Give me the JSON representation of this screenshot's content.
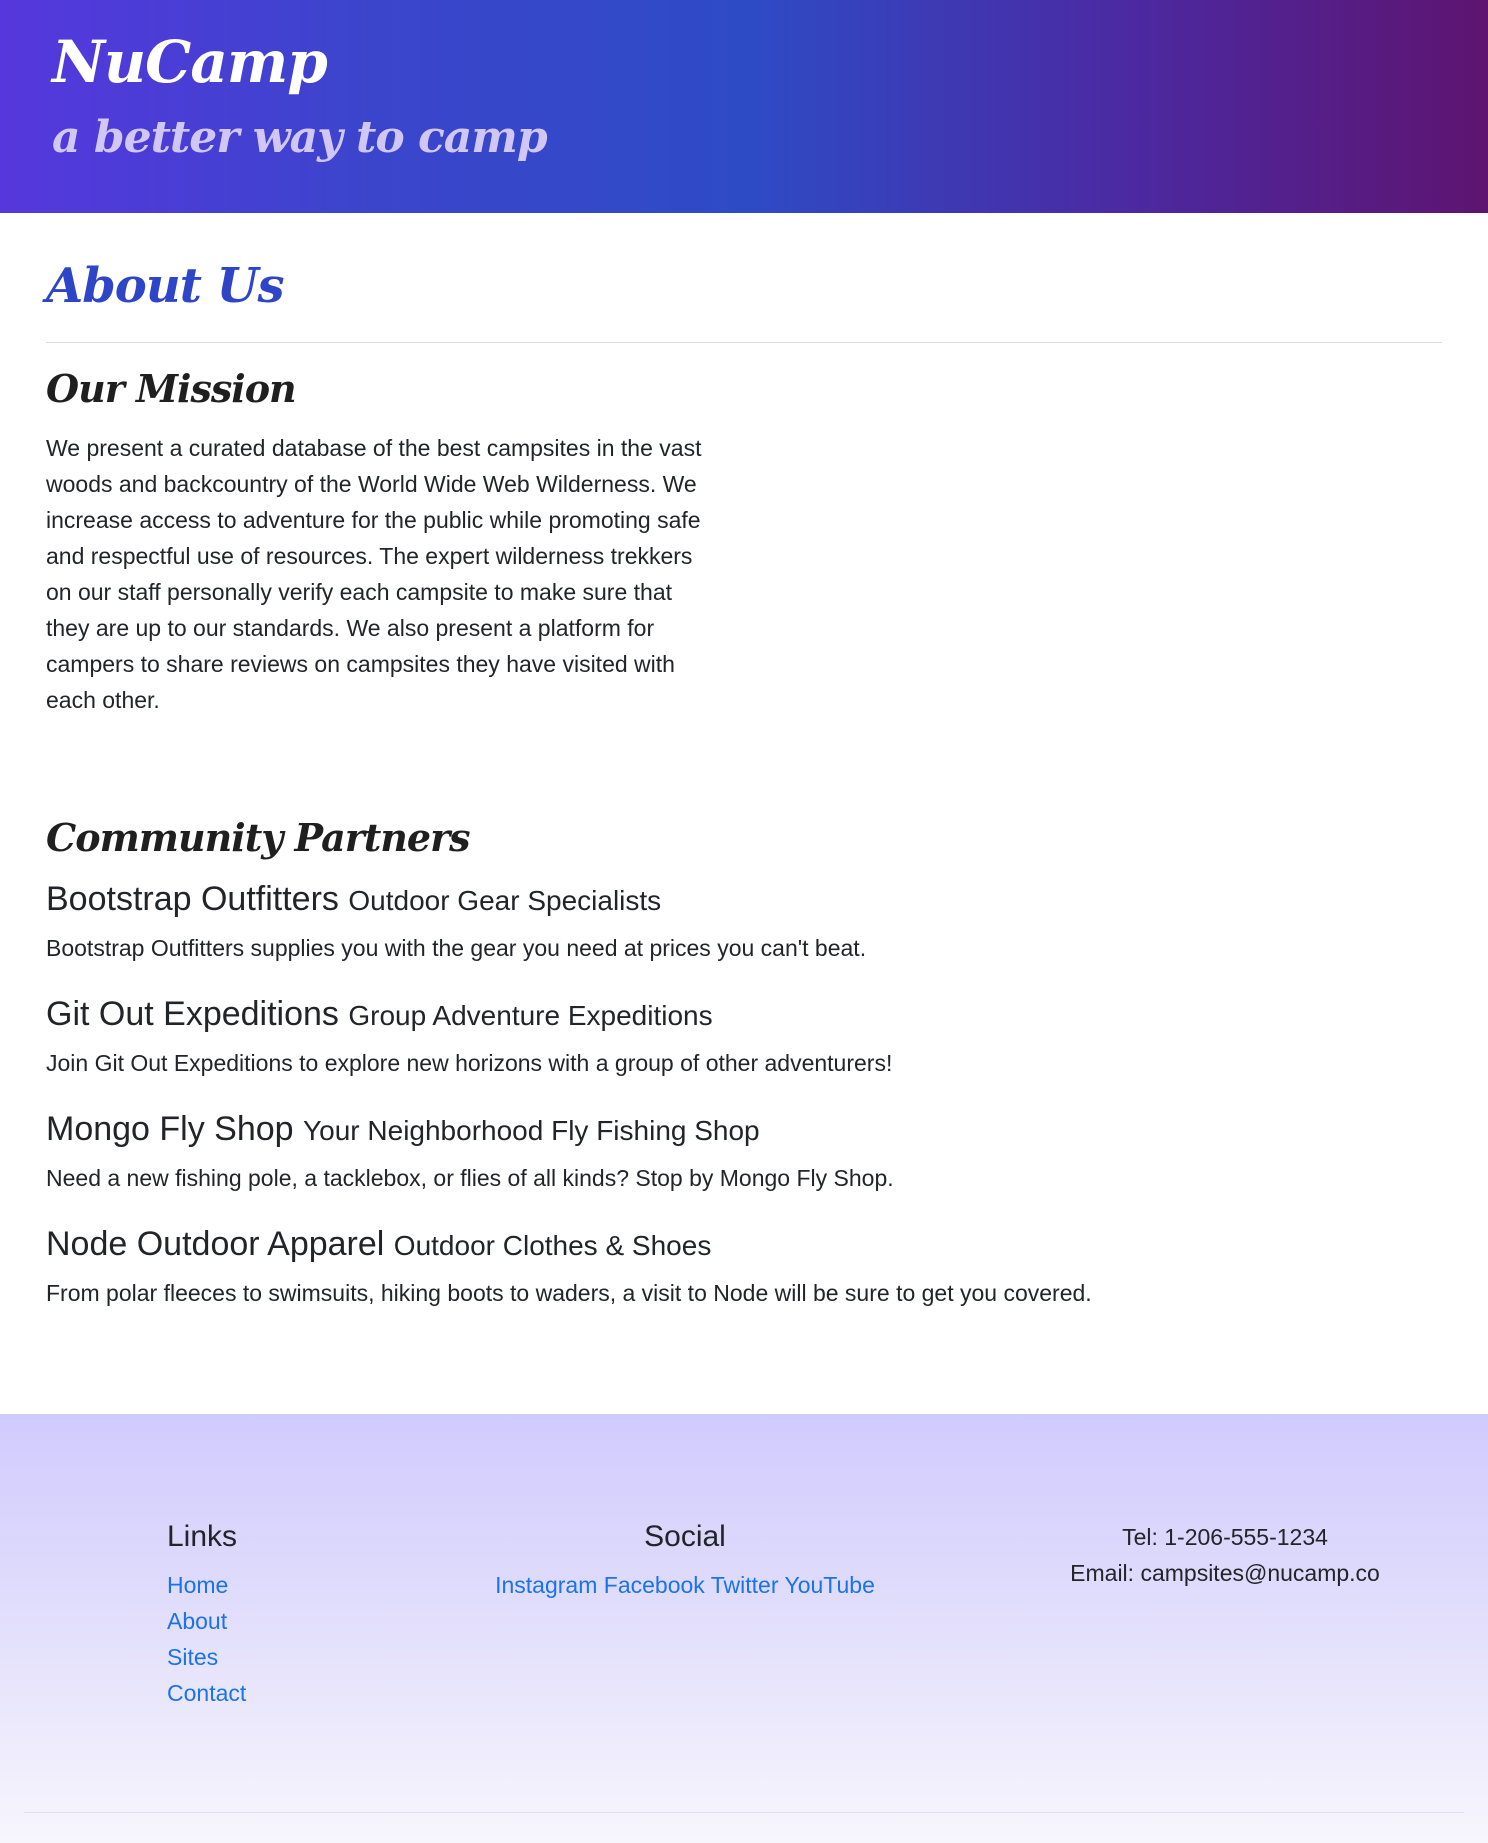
{
  "header": {
    "brand": "NuCamp",
    "tagline": "a better way to camp",
    "gradient_colors": [
      "#5637dd",
      "#2e4bc6",
      "#5e1470"
    ]
  },
  "main": {
    "title": "About Us",
    "mission": {
      "heading": "Our Mission",
      "text": "We present a curated database of the best campsites in the vast woods and backcountry of the World Wide Web Wilderness. We increase access to adventure for the public while promoting safe and respectful use of resources. The expert wilderness trekkers on our staff personally verify each campsite to make sure that they are up to our standards. We also present a platform for campers to share reviews on campsites they have visited with each other."
    },
    "partners": {
      "heading": "Community Partners",
      "items": [
        {
          "name": "Bootstrap Outfitters",
          "subtitle": "Outdoor Gear Specialists",
          "description": "Bootstrap Outfitters supplies you with the gear you need at prices you can't beat."
        },
        {
          "name": "Git Out Expeditions",
          "subtitle": "Group Adventure Expeditions",
          "description": "Join Git Out Expeditions to explore new horizons with a group of other adventurers!"
        },
        {
          "name": "Mongo Fly Shop",
          "subtitle": "Your Neighborhood Fly Fishing Shop",
          "description": "Need a new fishing pole, a tacklebox, or flies of all kinds? Stop by Mongo Fly Shop."
        },
        {
          "name": "Node Outdoor Apparel",
          "subtitle": "Outdoor Clothes & Shoes",
          "description": "From polar fleeces to swimsuits, hiking boots to waders, a visit to Node will be sure to get you covered."
        }
      ]
    }
  },
  "footer": {
    "links": {
      "heading": "Links",
      "items": [
        "Home",
        "About",
        "Sites",
        "Contact"
      ]
    },
    "social": {
      "heading": "Social",
      "items": [
        "Instagram",
        "Facebook",
        "Twitter",
        "YouTube"
      ]
    },
    "contact": {
      "tel": "Tel: 1-206-555-1234",
      "email": "Email: campsites@nucamp.co"
    },
    "link_color": "#1a73e8",
    "background_top": "#d0cbfd"
  }
}
